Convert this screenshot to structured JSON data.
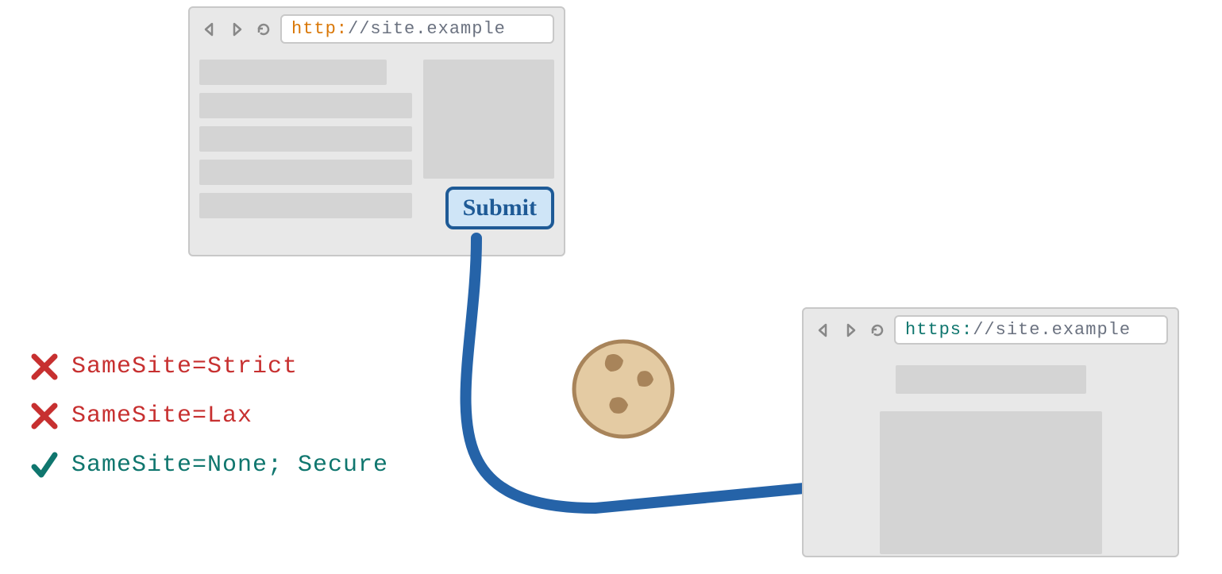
{
  "browser1": {
    "url_scheme": "http:",
    "url_rest": "//site.example",
    "submit_label": "Submit"
  },
  "browser2": {
    "url_scheme": "https:",
    "url_rest": "//site.example"
  },
  "legend": {
    "strict": {
      "text": "SameSite=Strict",
      "allowed": false
    },
    "lax": {
      "text": "SameSite=Lax",
      "allowed": false
    },
    "none": {
      "text": "SameSite=None; Secure",
      "allowed": true
    }
  },
  "colors": {
    "deny": "#c73030",
    "allow": "#0f766e",
    "arrow": "#2563a8",
    "http": "#d97706",
    "https": "#0f766e"
  }
}
